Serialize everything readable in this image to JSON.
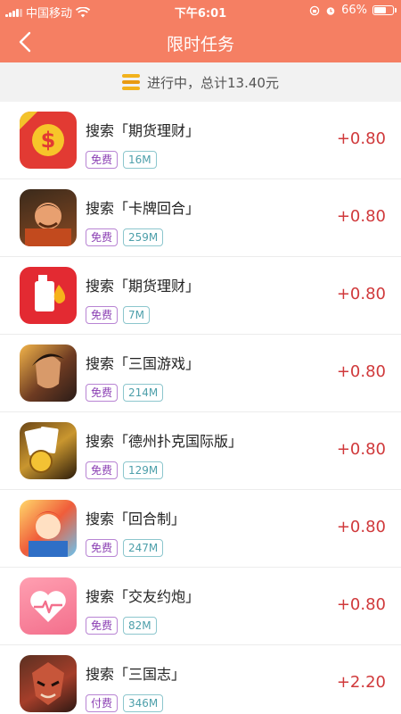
{
  "status_bar": {
    "carrier": "中国移动",
    "time": "下午6:01",
    "battery_percent": "66%",
    "battery_level": 0.66
  },
  "nav": {
    "title": "限时任务"
  },
  "summary": {
    "text": "进行中，总计13.40元"
  },
  "tasks": [
    {
      "title": "搜索「期货理财」",
      "price_tag": "免费",
      "size": "16M",
      "reward": "+0.80",
      "icon": "dollar-coin-icon"
    },
    {
      "title": "搜索「卡牌回合」",
      "price_tag": "免费",
      "size": "259M",
      "reward": "+0.80",
      "icon": "card-game-icon"
    },
    {
      "title": "搜索「期货理财」",
      "price_tag": "免费",
      "size": "7M",
      "reward": "+0.80",
      "icon": "oil-bottle-icon"
    },
    {
      "title": "搜索「三国游戏」",
      "price_tag": "免费",
      "size": "214M",
      "reward": "+0.80",
      "icon": "warrior-icon"
    },
    {
      "title": "搜索「德州扑克国际版」",
      "price_tag": "免费",
      "size": "129M",
      "reward": "+0.80",
      "icon": "poker-icon"
    },
    {
      "title": "搜索「回合制」",
      "price_tag": "免费",
      "size": "247M",
      "reward": "+0.80",
      "icon": "hero-icon"
    },
    {
      "title": "搜索「交友约炮」",
      "price_tag": "免费",
      "size": "82M",
      "reward": "+0.80",
      "icon": "heart-pulse-icon"
    },
    {
      "title": "搜索「三国志」",
      "price_tag": "付费",
      "size": "346M",
      "reward": "+2.20",
      "icon": "warrior-mask-icon"
    }
  ],
  "colors": {
    "header": "#f57f63",
    "reward": "#d0393b",
    "price_tag": "#8b3fb3",
    "size_tag": "#4d9faa"
  }
}
